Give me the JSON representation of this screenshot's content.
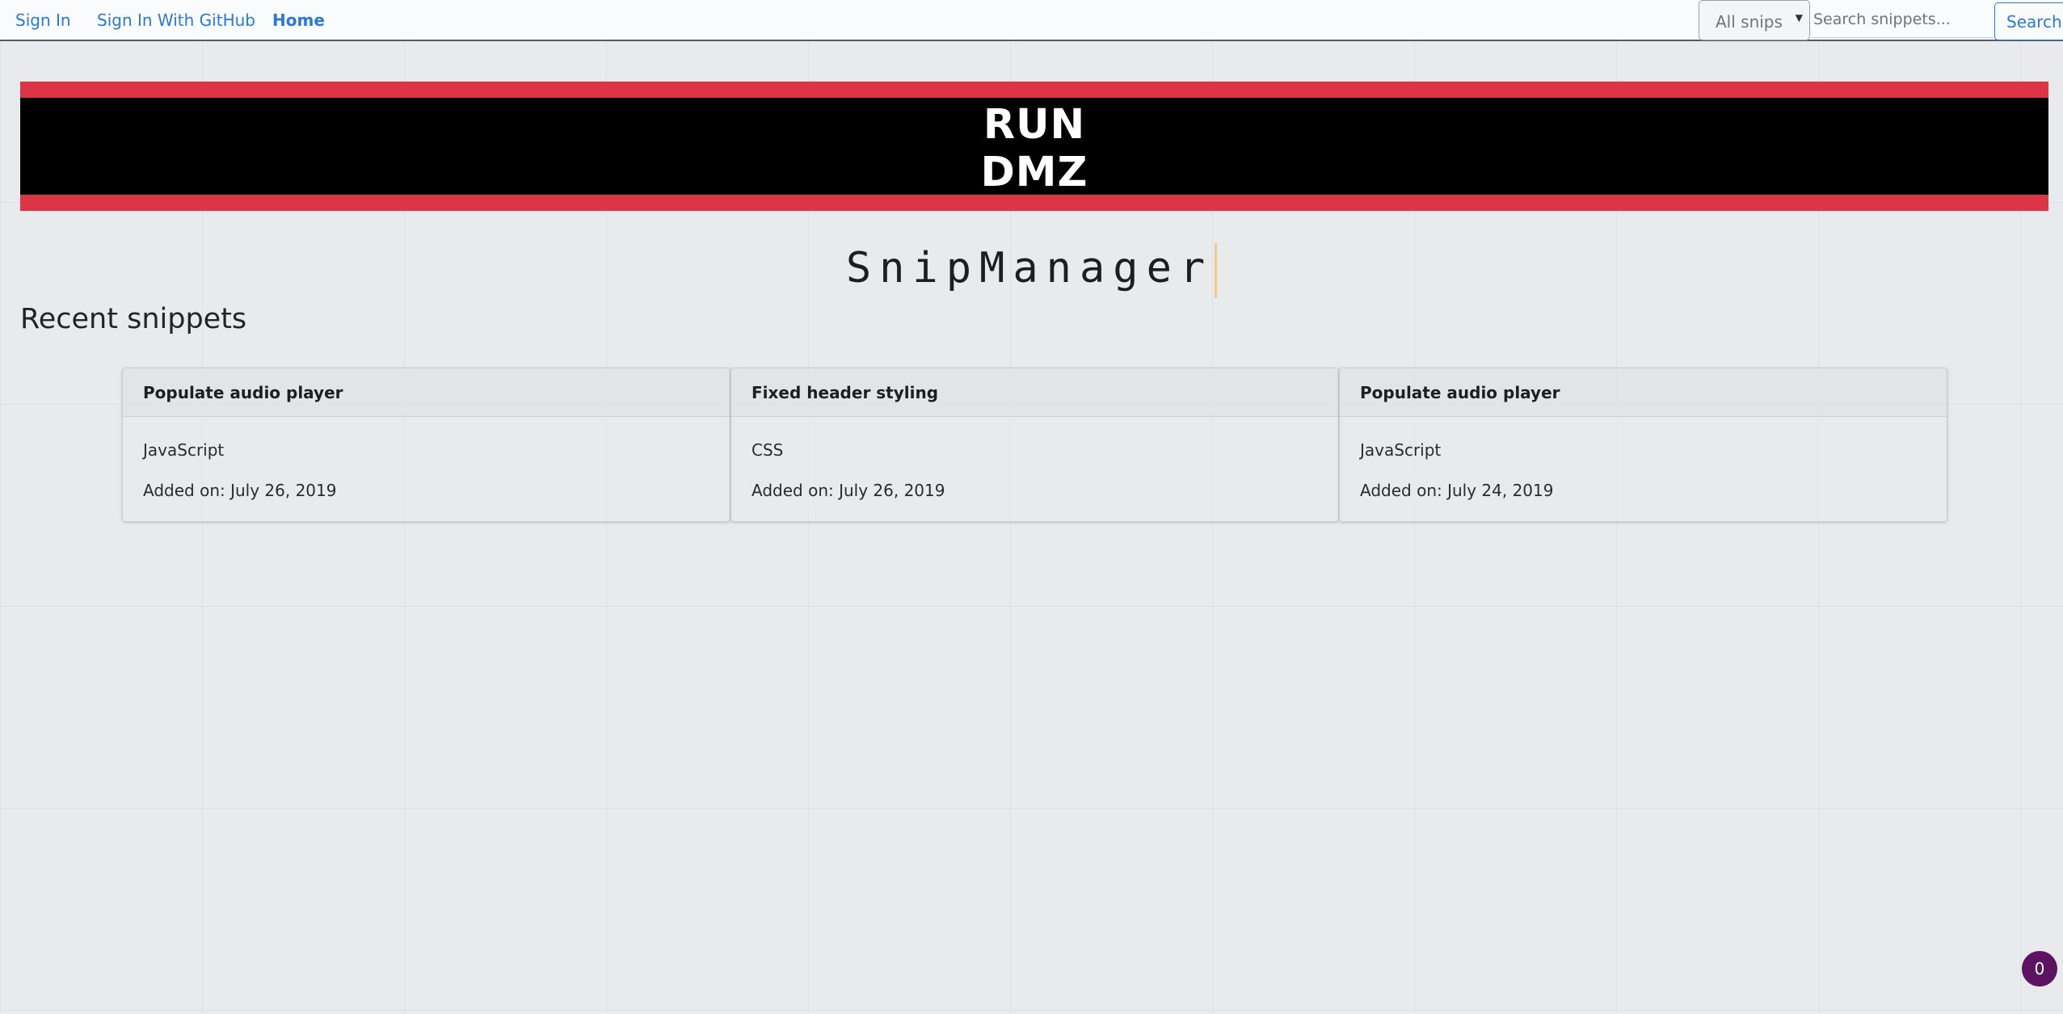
{
  "nav": {
    "sign_in": "Sign In",
    "sign_in_github": "Sign In With GitHub",
    "home": "Home",
    "select_value": "All snips",
    "search_placeholder": "Search snippets...",
    "search_button": "Search"
  },
  "banner": {
    "line1": "RUN",
    "line2": "DMZ"
  },
  "title": "SnipManager",
  "section_heading": "Recent snippets",
  "snippets": [
    {
      "title": "Populate audio player",
      "language": "JavaScript",
      "added": "Added on: July 26, 2019"
    },
    {
      "title": "Fixed header styling",
      "language": "CSS",
      "added": "Added on: July 26, 2019"
    },
    {
      "title": "Populate audio player",
      "language": "JavaScript",
      "added": "Added on: July 24, 2019"
    }
  ],
  "notification_count": "0",
  "colors": {
    "accent": "#2a7ad2",
    "banner_red": "#dc3545",
    "banner_black": "#000000",
    "badge": "#5c1460"
  }
}
